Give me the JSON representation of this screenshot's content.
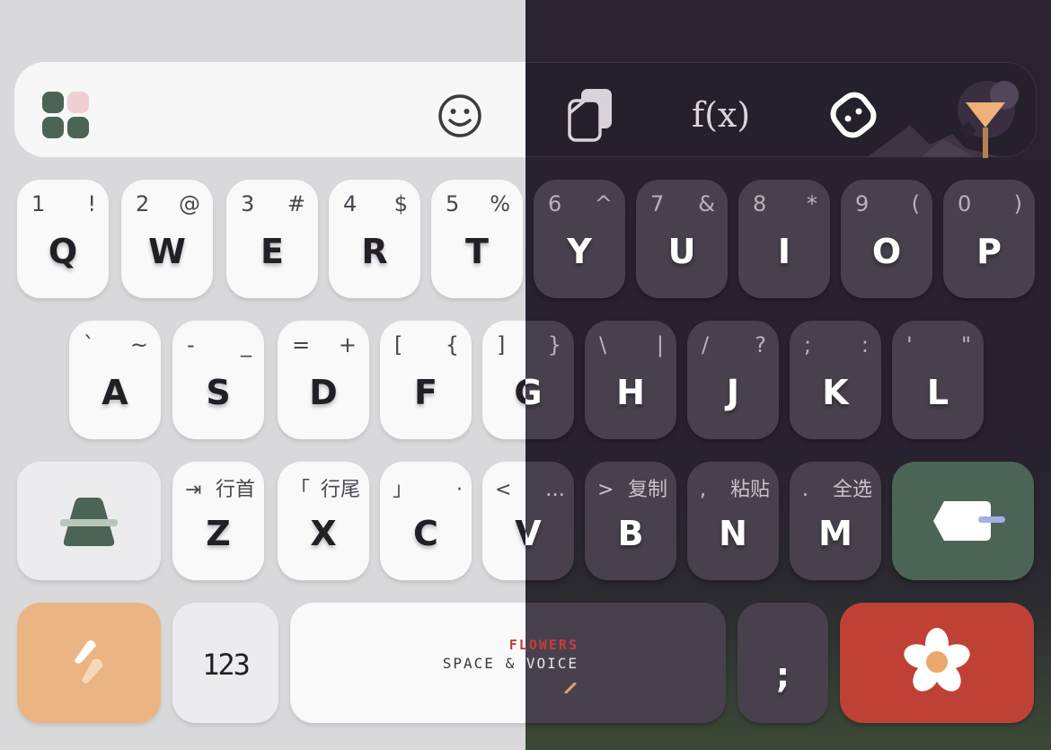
{
  "toolbar": {
    "icons": [
      "apps-grid-icon",
      "emoji-icon",
      "clipboard-icon",
      "function-icon",
      "link-icon",
      "theme-avatar-icon"
    ],
    "function_label": "f(x)"
  },
  "rows": {
    "row1": [
      {
        "main": "Q",
        "hint_left": "1",
        "hint_right": "!"
      },
      {
        "main": "W",
        "hint_left": "2",
        "hint_right": "@"
      },
      {
        "main": "E",
        "hint_left": "3",
        "hint_right": "#"
      },
      {
        "main": "R",
        "hint_left": "4",
        "hint_right": "$"
      },
      {
        "main": "T",
        "hint_left": "5",
        "hint_right": "%"
      },
      {
        "main": "Y",
        "hint_left": "6",
        "hint_right": "^"
      },
      {
        "main": "U",
        "hint_left": "7",
        "hint_right": "&"
      },
      {
        "main": "I",
        "hint_left": "8",
        "hint_right": "*"
      },
      {
        "main": "O",
        "hint_left": "9",
        "hint_right": "("
      },
      {
        "main": "P",
        "hint_left": "0",
        "hint_right": ")"
      }
    ],
    "row2": [
      {
        "main": "A",
        "hint_left": "`",
        "hint_right": "~"
      },
      {
        "main": "S",
        "hint_left": "-",
        "hint_right": "_"
      },
      {
        "main": "D",
        "hint_left": "=",
        "hint_right": "+"
      },
      {
        "main": "F",
        "hint_left": "[",
        "hint_right": "{"
      },
      {
        "main": "G",
        "hint_left": "]",
        "hint_right": "}"
      },
      {
        "main": "H",
        "hint_left": "\\",
        "hint_right": "|"
      },
      {
        "main": "J",
        "hint_left": "/",
        "hint_right": "?"
      },
      {
        "main": "K",
        "hint_left": ";",
        "hint_right": ":"
      },
      {
        "main": "L",
        "hint_left": "'",
        "hint_right": "\""
      }
    ],
    "row3": [
      {
        "main": "Z",
        "hint_left": "⇥",
        "hint_right": "行首"
      },
      {
        "main": "X",
        "hint_left": "「",
        "hint_right": "行尾"
      },
      {
        "main": "C",
        "hint_left": "」",
        "hint_right": "·"
      },
      {
        "main": "V",
        "hint_left": "<",
        "hint_right": "…"
      },
      {
        "main": "B",
        "hint_left": ">",
        "hint_right": "复制"
      },
      {
        "main": "N",
        "hint_left": ",",
        "hint_right": "粘贴"
      },
      {
        "main": "M",
        "hint_left": ".",
        "hint_right": "全选"
      }
    ]
  },
  "bottom": {
    "num_label": "123",
    "space_label_top": "FLOWERS",
    "space_label": "SPACE & VOICE",
    "semicolon": ";"
  },
  "colors": {
    "light_bg": "#d9d9db",
    "dark_bg": "#281f2f",
    "enter": "#4c6455",
    "flash": "#eab582",
    "flower": "#bf4136",
    "accent_red": "#c2403a"
  }
}
